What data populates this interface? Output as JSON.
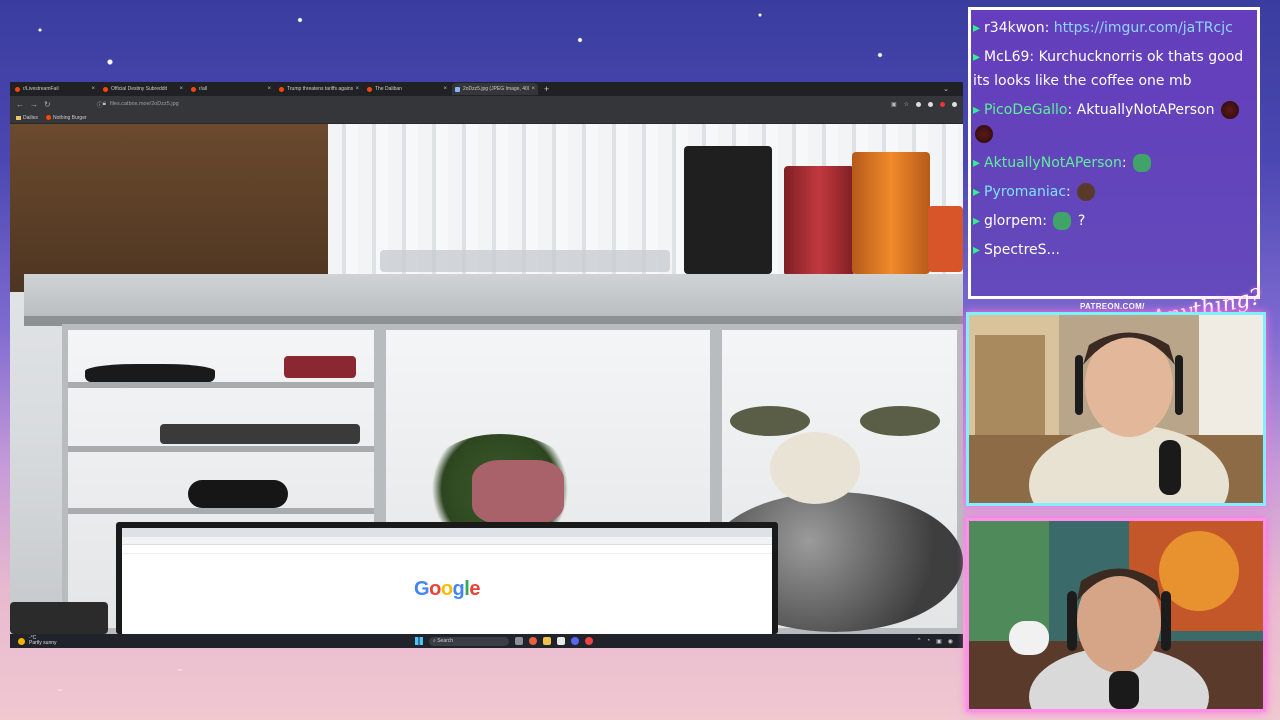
{
  "browser": {
    "tabs": [
      {
        "label": "r/LivestreamFail",
        "active": false
      },
      {
        "label": "Official Destiny Subreddit",
        "active": false
      },
      {
        "label": "r/all",
        "active": false
      },
      {
        "label": "Trump threatens tariffs against",
        "active": false
      },
      {
        "label": "The Daliban",
        "active": false
      },
      {
        "label": "2oDzz5.jpg (JPEG Image, 4000",
        "active": true
      }
    ],
    "new_tab": "+",
    "tab_menu": "⌄",
    "url": "files.catbox.moe/2oDzz5.jpg",
    "bookmarks": [
      {
        "label": "Dailies",
        "icon": "folder-icon"
      },
      {
        "label": "Nothing Burger",
        "icon": "reddit-icon"
      }
    ]
  },
  "monitor": {
    "google_letters": [
      "G",
      "o",
      "o",
      "g",
      "l",
      "e"
    ]
  },
  "taskbar": {
    "weather_temp": "-°C",
    "weather_desc": "Partly sunny",
    "search_label": "Search"
  },
  "chat": {
    "messages": [
      {
        "user": "r34kwon",
        "color": "user-white",
        "text": "https://imgur.com/jaTRcjc",
        "is_link": true
      },
      {
        "user": "McL69",
        "color": "user-white",
        "text": "Kurchucknorris ok thats good its looks like the coffee one mb",
        "is_link": false
      },
      {
        "user": "PicoDeGallo",
        "color": "user-green",
        "text": "AktuallyNotAPerson",
        "is_link": false
      },
      {
        "user": "AktuallyNotAPerson",
        "color": "user-green",
        "text": "",
        "is_link": false
      },
      {
        "user": "Pyromaniac",
        "color": "user-cyan",
        "text": "",
        "is_link": false
      },
      {
        "user": "glorpem",
        "color": "user-white",
        "text": "?",
        "is_link": false
      },
      {
        "user": "SpectreS...",
        "color": "user-white",
        "text": "",
        "is_link": false
      }
    ]
  },
  "overlay": {
    "patreon_label": "PATREON.COM/",
    "signature": "Anything?"
  },
  "colors": {
    "chat_border": "#ffffff",
    "cam_top_border": "#7ff0ff",
    "cam_bottom_border": "#ff8fe8",
    "username_green": "#5ff09a"
  }
}
